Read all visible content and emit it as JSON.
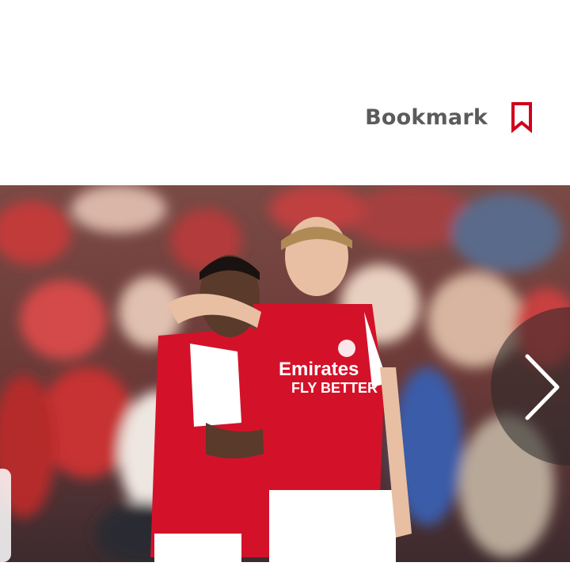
{
  "header": {
    "bookmark_label": "Bookmark",
    "bookmark_icon": "bookmark-icon"
  },
  "hero": {
    "image_description": "Two football players in red and white kits celebrating in front of a crowd",
    "next_icon": "chevron-right-icon",
    "shirt_sponsor": "Emirates FLY BETTER"
  },
  "colors": {
    "accent_red": "#d0021b",
    "label_gray": "#5b5b5b",
    "kit_red": "#d3122a"
  }
}
